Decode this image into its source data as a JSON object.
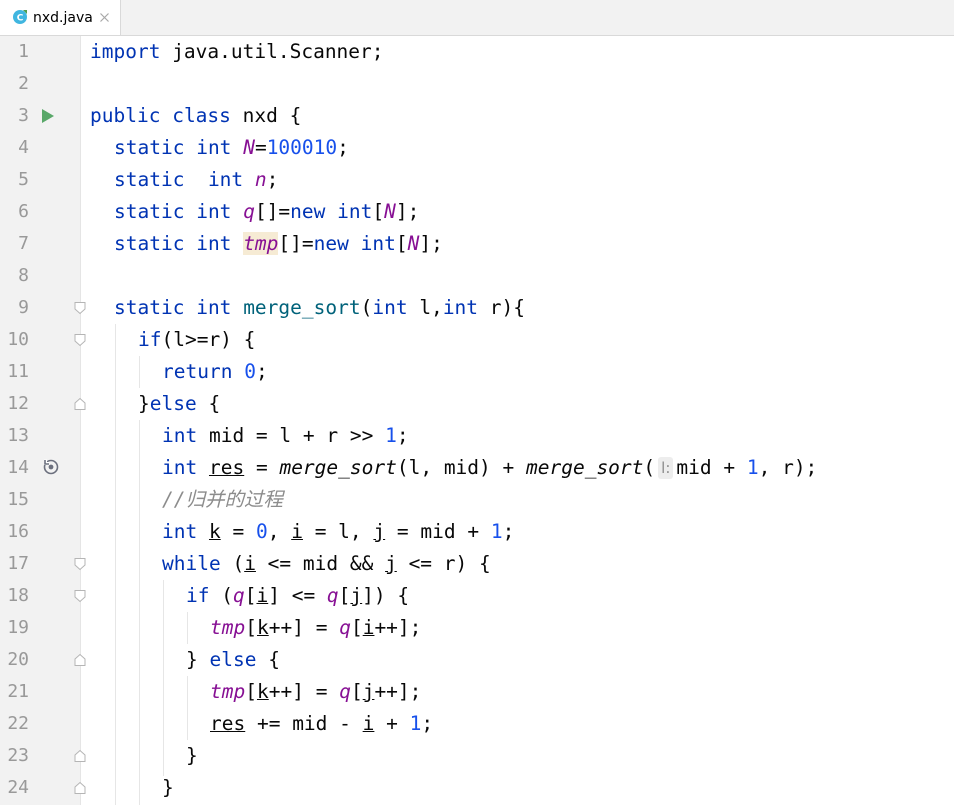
{
  "tab": {
    "filename": "nxd.java",
    "icon": "java-class-icon",
    "close_icon": "close-icon"
  },
  "colors": {
    "keyword": "#0033b3",
    "number": "#1750eb",
    "field": "#871094",
    "method": "#00627a",
    "comment": "#8c8c8c",
    "text": "#080808",
    "gutter_bg": "#f2f2f2",
    "line_number": "#999999"
  },
  "gutter_icons": {
    "run": "run-icon",
    "recursive": "recursive-call-icon",
    "fold": "fold-icon"
  },
  "line_numbers": [
    "1",
    "2",
    "3",
    "4",
    "5",
    "6",
    "7",
    "8",
    "9",
    "10",
    "11",
    "12",
    "13",
    "14",
    "15",
    "16",
    "17",
    "18",
    "19",
    "20",
    "21",
    "22",
    "23",
    "24"
  ],
  "code": {
    "l1": [
      "import",
      " java.util.Scanner;"
    ],
    "l3": [
      "public",
      " ",
      "class",
      " nxd {"
    ],
    "l4": [
      "static",
      " ",
      "int",
      " ",
      "N",
      "=",
      "100010",
      ";"
    ],
    "l5": [
      "static",
      "  ",
      "int",
      " ",
      "n",
      ";"
    ],
    "l6": [
      "static",
      " ",
      "int",
      " ",
      "q",
      "[]=",
      "new",
      " ",
      "int",
      "[",
      "N",
      "];"
    ],
    "l7": [
      "static",
      " ",
      "int",
      " ",
      "tmp",
      "[]=",
      "new",
      " ",
      "int",
      "[",
      "N",
      "];"
    ],
    "l9": [
      "static",
      " ",
      "int",
      " ",
      "merge_sort",
      "(",
      "int",
      " l,",
      "int",
      " r){"
    ],
    "l10": [
      "if",
      "(l>=r) {"
    ],
    "l11": [
      "return",
      " ",
      "0",
      ";"
    ],
    "l12": [
      "}",
      "else",
      " {"
    ],
    "l13": [
      "int",
      " mid = l + r >> ",
      "1",
      ";"
    ],
    "l14": [
      "int",
      " ",
      "res",
      " = ",
      "merge_sort",
      "(l, mid) + ",
      "merge_sort",
      "(",
      "l:",
      "mid + ",
      "1",
      ", r);"
    ],
    "l15": [
      "//归并的过程"
    ],
    "l16": [
      "int",
      " ",
      "k",
      " = ",
      "0",
      ", ",
      "i",
      " = l, ",
      "j",
      " = mid + ",
      "1",
      ";"
    ],
    "l17": [
      "while",
      " (",
      "i",
      " <= mid && ",
      "j",
      " <= r) {"
    ],
    "l18": [
      "if",
      " (",
      "q",
      "[",
      "i",
      "] <= ",
      "q",
      "[",
      "j",
      "]) {"
    ],
    "l19": [
      "tmp",
      "[",
      "k",
      "++] = ",
      "q",
      "[",
      "i",
      "++];"
    ],
    "l20": [
      "} ",
      "else",
      " {"
    ],
    "l21": [
      "tmp",
      "[",
      "k",
      "++] = ",
      "q",
      "[",
      "j",
      "++];"
    ],
    "l22": [
      "res",
      " += mid - ",
      "i",
      " + ",
      "1",
      ";"
    ],
    "l23": [
      "}"
    ],
    "l24": [
      "}"
    ]
  }
}
